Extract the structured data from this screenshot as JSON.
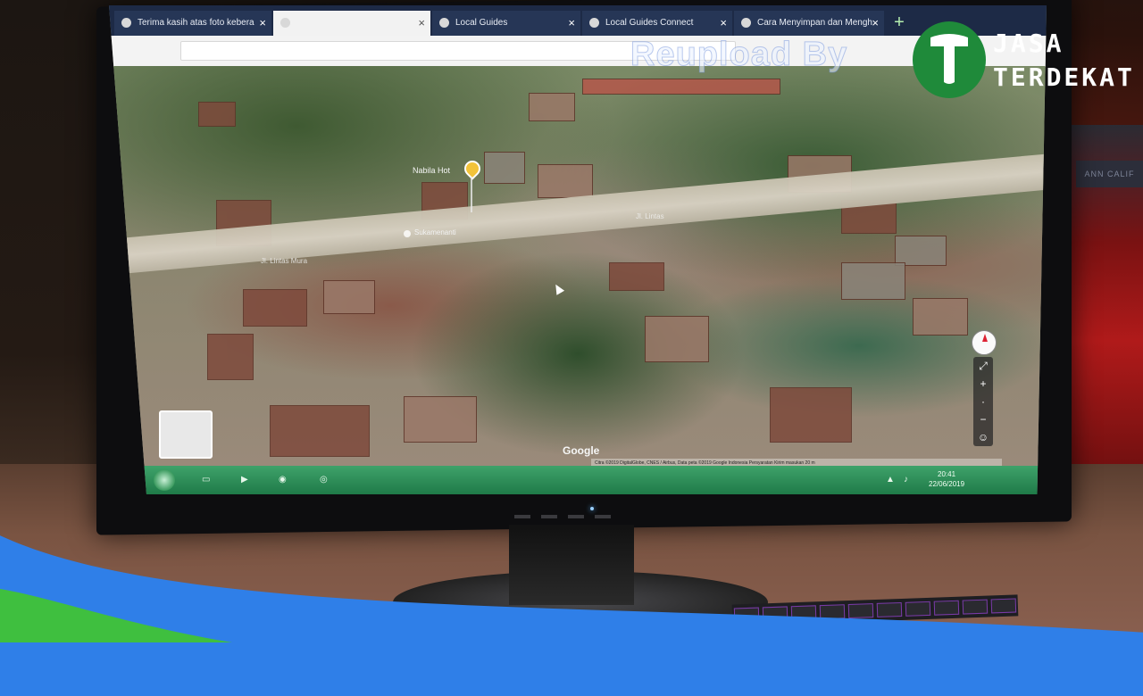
{
  "browser": {
    "tabs": [
      {
        "label": "Terima kasih atas foto kebera"
      },
      {
        "label": ""
      },
      {
        "label": "Local Guides"
      },
      {
        "label": "Local Guides Connect"
      },
      {
        "label": "Cara Menyimpan dan Mengh"
      }
    ]
  },
  "map": {
    "pin_label": "Nabila Hot",
    "place_label": "Sukamenanti",
    "road_label_left": "Jl. Lintas Mura",
    "road_label_right": "Jl. Lintas",
    "logo": "Google",
    "attribution": "Citra ©2019 DigitalGlobe, CNES / Airbus, Data peta ©2019 Google  Indonesia  Persyaratan  Kirim masukan  20 m"
  },
  "taskbar": {
    "time": "20:41",
    "date": "22/06/2019"
  },
  "watermark": {
    "reupload": "Reupload By",
    "logo_line1": "JASA",
    "logo_line2": "TERDEKAT"
  },
  "chair_label": "ANN CALIF",
  "colors": {
    "tab_bar": "#1d2a46",
    "taskbar_green": "#1f7a48",
    "brand_green": "#1f8a3a",
    "wave_blue": "#2f7fe8",
    "wave_green": "#3fbf3f"
  }
}
